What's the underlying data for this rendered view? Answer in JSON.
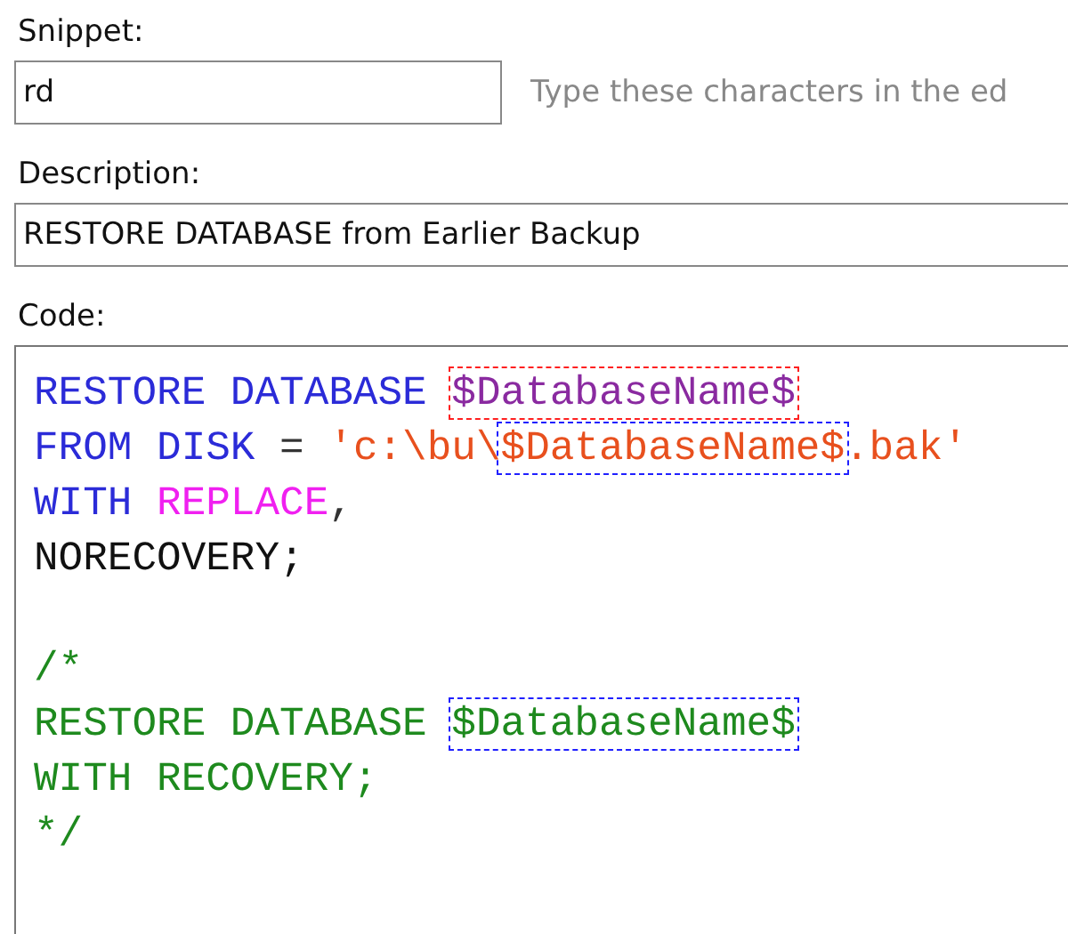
{
  "snippet": {
    "label": "Snippet:",
    "value": "rd",
    "hint": "Type these characters in the ed"
  },
  "description": {
    "label": "Description:",
    "value": "RESTORE DATABASE from Earlier Backup"
  },
  "code": {
    "label": "Code:",
    "lines": [
      {
        "tokens": [
          {
            "kind": "keyword",
            "text": "RESTORE DATABASE"
          },
          {
            "kind": "variable",
            "text": "$DatabaseName$",
            "color": "#ff2020"
          }
        ]
      },
      {
        "tokens": [
          {
            "kind": "keyword",
            "text": "FROM DISK"
          },
          {
            "kind": "operator",
            "text": "="
          },
          {
            "kind": "string",
            "text": "'c:\\bu\\"
          },
          {
            "kind": "string",
            "text": "$DatabaseName$",
            "color": "#2020ff",
            "join": true
          },
          {
            "kind": "string",
            "text": ".bak'",
            "join": true
          }
        ]
      },
      {
        "tokens": [
          {
            "kind": "keyword",
            "text": "WITH"
          },
          {
            "kind": "function",
            "text": "REPLACE"
          },
          {
            "kind": "operator",
            "text": ",",
            "join": true
          }
        ]
      },
      {
        "tokens": [
          {
            "kind": "plain",
            "text": "NORECOVERY;"
          }
        ]
      },
      {
        "kind": "blank"
      },
      {
        "tokens": [
          {
            "kind": "comment",
            "text": "/*"
          }
        ]
      },
      {
        "tokens": [
          {
            "kind": "comment",
            "text": "RESTORE DATABASE"
          },
          {
            "kind": "comment",
            "text": "$DatabaseName$",
            "color": "#2020ff"
          }
        ]
      },
      {
        "tokens": [
          {
            "kind": "comment",
            "text": "WITH RECOVERY;"
          }
        ]
      },
      {
        "tokens": [
          {
            "kind": "comment",
            "text": "*/"
          }
        ]
      }
    ]
  }
}
